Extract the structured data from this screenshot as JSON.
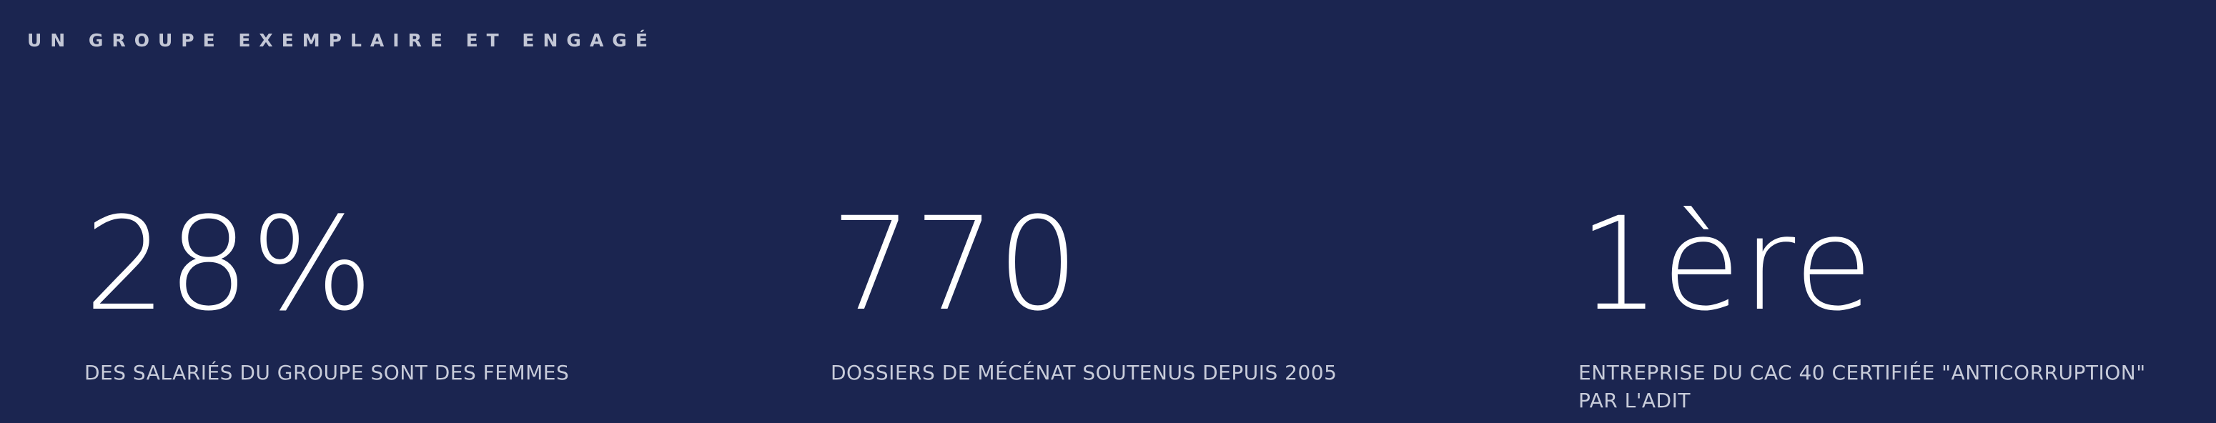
{
  "section": {
    "eyebrow": "UN GROUPE EXEMPLAIRE ET ENGAGÉ"
  },
  "stats": [
    {
      "value": "28%",
      "label_lines": [
        "DES SALARIÉS DU GROUPE SONT DES FEMMES"
      ]
    },
    {
      "value": "770",
      "label_lines": [
        "DOSSIERS DE MÉCÉNAT SOUTENUS DEPUIS 2005"
      ]
    },
    {
      "value": "1ère",
      "label_lines": [
        "ENTREPRISE DU CAC 40 CERTIFIÉE \"ANTICORRUPTION\"",
        "PAR L'ADIT"
      ]
    }
  ],
  "colors": {
    "background": "#1b2550",
    "value_text": "#ffffff",
    "label_text": "#c8ccda",
    "eyebrow_text": "#c3c7d6"
  }
}
